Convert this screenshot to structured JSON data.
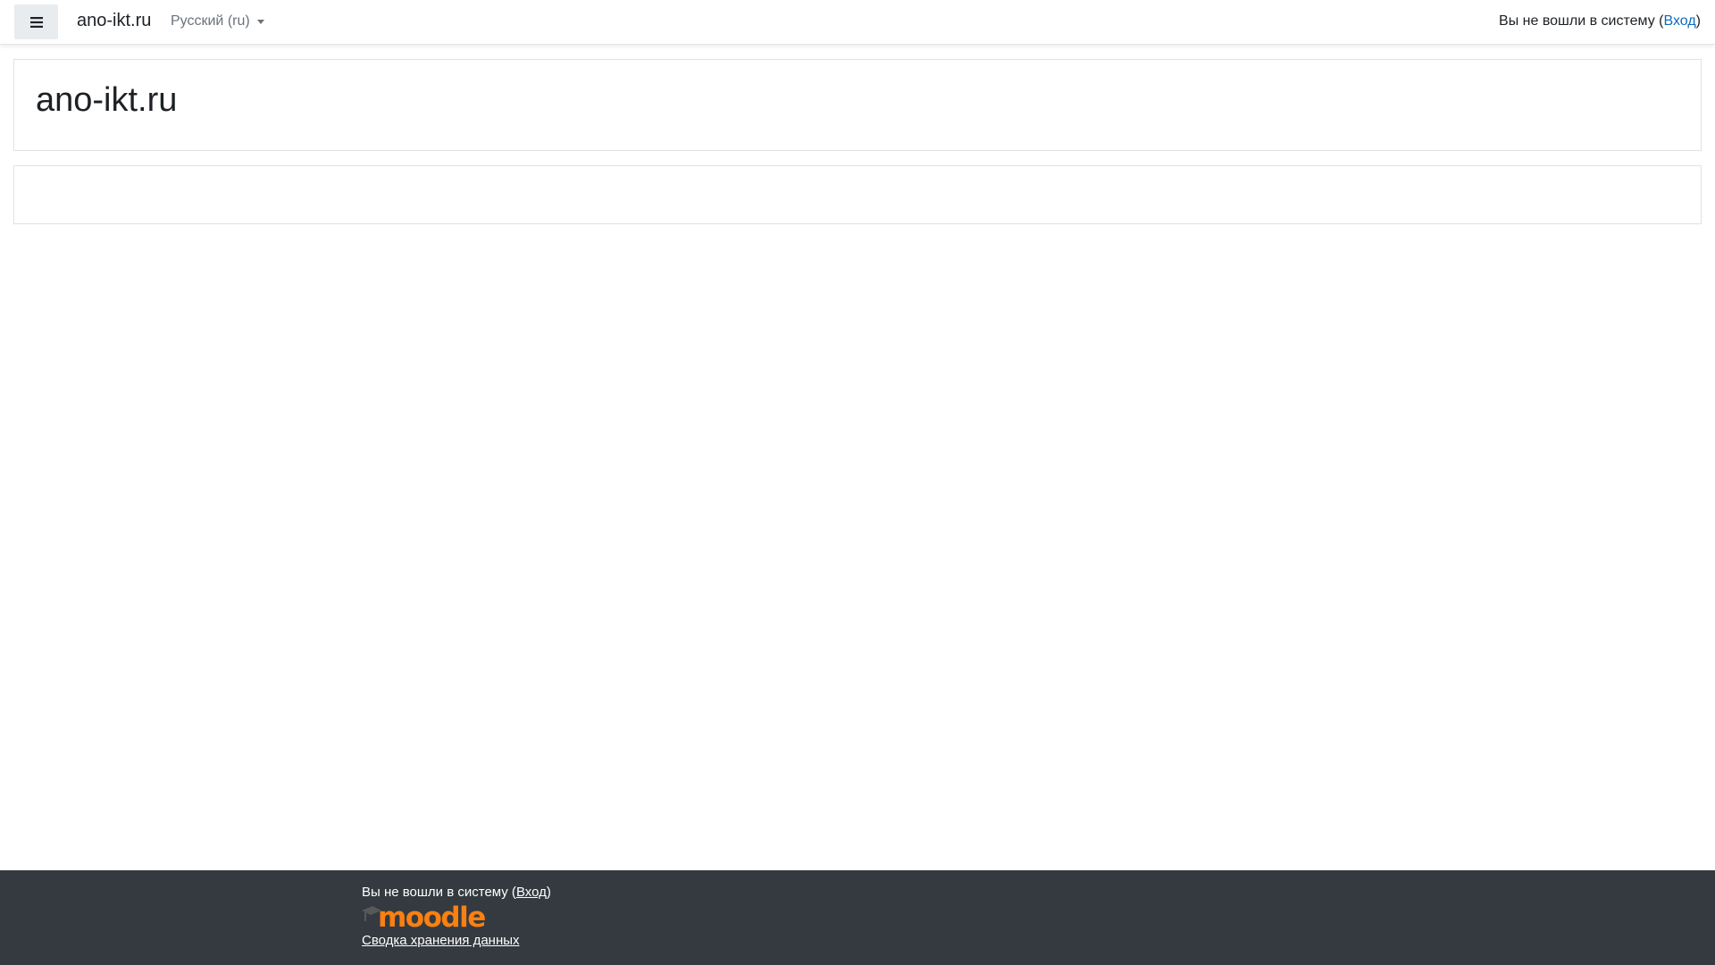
{
  "navbar": {
    "menu_icon": "hamburger-menu-icon",
    "brand": "ano-ikt.ru",
    "language": "Русский ‎(ru)‎",
    "login_prefix": "Вы не вошли в систему (",
    "login_link": "Вход",
    "login_suffix": ")"
  },
  "header": {
    "title": "ano-ikt.ru"
  },
  "footer": {
    "login_prefix": "Вы не вошли в систему (",
    "login_link": "Вход",
    "login_suffix": ")",
    "logo_text": "moodle",
    "data_policy": "Сводка хранения данных"
  },
  "colors": {
    "link": "#0f6cbf",
    "footer_bg": "#343a40",
    "moodle_orange": "#f98012"
  }
}
